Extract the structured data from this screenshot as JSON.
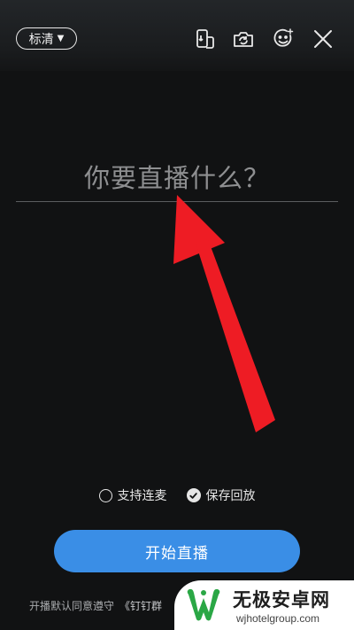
{
  "header": {
    "quality_label": "标清",
    "icons": [
      "switch-screen-icon",
      "flip-camera-icon",
      "beauty-face-icon",
      "close-icon"
    ]
  },
  "topic": {
    "placeholder": "你要直播什么？"
  },
  "options": {
    "connect_mic_label": "支持连麦",
    "connect_mic_checked": false,
    "save_replay_label": "保存回放",
    "save_replay_checked": true
  },
  "start_button_label": "开始直播",
  "agreement": {
    "prefix": "开播默认同意遵守",
    "link": "《钉钉群"
  },
  "watermark": {
    "name": "无极安卓网",
    "url": "wjhotelgroup.com"
  },
  "colors": {
    "background": "#111213",
    "accent": "#3a8ee6",
    "annotation_arrow": "#ee1c24"
  }
}
